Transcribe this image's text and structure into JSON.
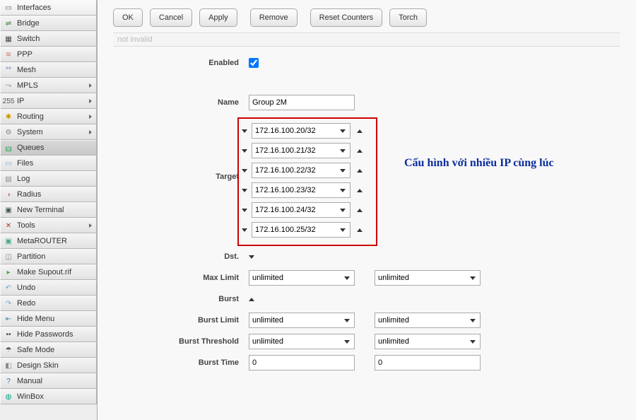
{
  "sidebar": [
    {
      "label": "Interfaces",
      "icon": "▭",
      "sub": false,
      "color": "#555"
    },
    {
      "label": "Bridge",
      "icon": "⇌",
      "sub": false,
      "color": "#3a7f3a"
    },
    {
      "label": "Switch",
      "icon": "▦",
      "sub": false,
      "color": "#444"
    },
    {
      "label": "PPP",
      "icon": "≋",
      "sub": false,
      "color": "#c77"
    },
    {
      "label": "Mesh",
      "icon": "°°",
      "sub": false,
      "color": "#46a"
    },
    {
      "label": "MPLS",
      "icon": "⤳",
      "sub": true,
      "color": "#777"
    },
    {
      "label": "IP",
      "icon": "255",
      "sub": true,
      "color": "#555"
    },
    {
      "label": "Routing",
      "icon": "✱",
      "sub": true,
      "color": "#c90"
    },
    {
      "label": "System",
      "icon": "⚙",
      "sub": true,
      "color": "#888"
    },
    {
      "label": "Queues",
      "icon": "🜲",
      "sub": false,
      "color": "#2a5",
      "active": true
    },
    {
      "label": "Files",
      "icon": "▭",
      "sub": false,
      "color": "#7ad"
    },
    {
      "label": "Log",
      "icon": "▤",
      "sub": false,
      "color": "#888"
    },
    {
      "label": "Radius",
      "icon": "◑",
      "sub": false,
      "color": "#c77"
    },
    {
      "label": "New Terminal",
      "icon": "▣",
      "sub": false,
      "color": "#455"
    },
    {
      "label": "Tools",
      "icon": "✕",
      "sub": true,
      "color": "#a33"
    },
    {
      "label": "MetaROUTER",
      "icon": "▣",
      "sub": false,
      "color": "#4a8"
    },
    {
      "label": "Partition",
      "icon": "◫",
      "sub": false,
      "color": "#888"
    },
    {
      "label": "Make Supout.rif",
      "icon": "▸",
      "sub": false,
      "color": "#4a4"
    },
    {
      "label": "Undo",
      "icon": "↶",
      "sub": false,
      "color": "#6ad"
    },
    {
      "label": "Redo",
      "icon": "↷",
      "sub": false,
      "color": "#6ad"
    },
    {
      "label": "Hide Menu",
      "icon": "⇤",
      "sub": false,
      "color": "#48a"
    },
    {
      "label": "Hide Passwords",
      "icon": "••",
      "sub": false,
      "color": "#444"
    },
    {
      "label": "Safe Mode",
      "icon": "☂",
      "sub": false,
      "color": "#555"
    },
    {
      "label": "Design Skin",
      "icon": "◧",
      "sub": false,
      "color": "#888"
    },
    {
      "label": "Manual",
      "icon": "?",
      "sub": false,
      "color": "#27a"
    },
    {
      "label": "WinBox",
      "icon": "◍",
      "sub": false,
      "color": "#0a8"
    }
  ],
  "buttons": {
    "ok": "OK",
    "cancel": "Cancel",
    "apply": "Apply",
    "remove": "Remove",
    "reset": "Reset Counters",
    "torch": "Torch"
  },
  "status": "not invalid",
  "form": {
    "enabled_label": "Enabled",
    "enabled": true,
    "name_label": "Name",
    "name": "Group 2M",
    "target_label": "Target",
    "targets": [
      "172.16.100.20/32",
      "172.16.100.21/32",
      "172.16.100.22/32",
      "172.16.100.23/32",
      "172.16.100.24/32",
      "172.16.100.25/32"
    ],
    "dst_label": "Dst.",
    "maxlimit_label": "Max Limit",
    "maxlimit_a": "unlimited",
    "maxlimit_b": "unlimited",
    "burst_label": "Burst",
    "burstlimit_label": "Burst Limit",
    "burstlimit_a": "unlimited",
    "burstlimit_b": "unlimited",
    "burstthres_label": "Burst Threshold",
    "burstthres_a": "unlimited",
    "burstthres_b": "unlimited",
    "bursttime_label": "Burst Time",
    "bursttime_a": "0",
    "bursttime_b": "0"
  },
  "annotation": "Cấu hình với nhiều IP cùng lúc"
}
